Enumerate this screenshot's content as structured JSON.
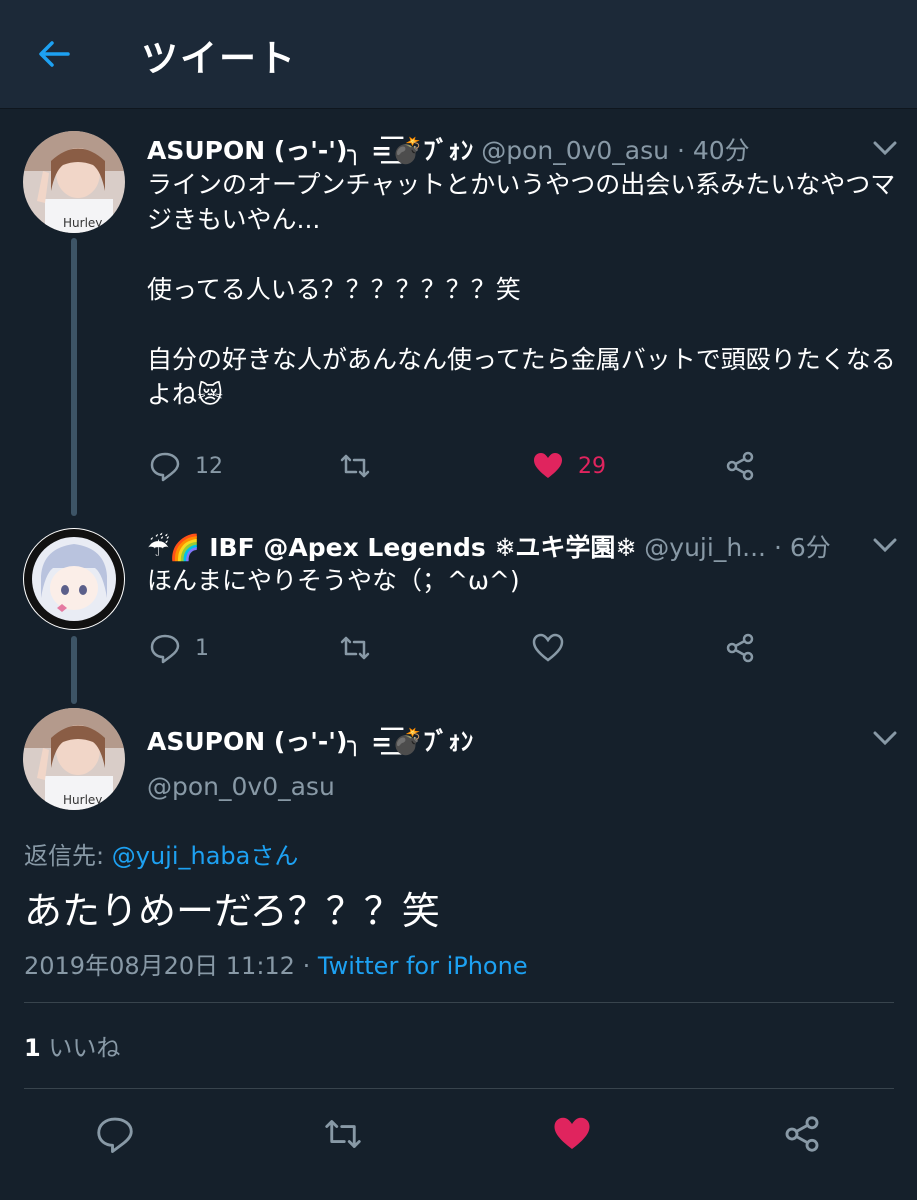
{
  "header": {
    "title": "ツイート"
  },
  "tweet1": {
    "name": "ASUPON (っ'-')╮ =͟͟͞͞💣ﾌﾞｫﾝ",
    "handle": "@pon_0v0_asu",
    "time": "· 40分",
    "text": "ラインのオープンチャットとかいうやつの出会い系みたいなやつマジきもいやん...\n\n使ってる人いる？？？？？？？笑\n\n自分の好きな人があんなん使ってたら金属バットで頭殴りたくなるよね😿",
    "replies": "12",
    "likes": "29"
  },
  "tweet2": {
    "name": "☔🌈 IBF @Apex Legends ❄ユキ学園❄",
    "handle": "@yuji_h...",
    "time": "· 6分",
    "text": "ほんまにやりそうやな（；^ω^)",
    "replies": "1"
  },
  "main": {
    "name": "ASUPON (っ'-')╮ =͟͟͞͞💣ﾌﾞｫﾝ",
    "handle": "@pon_0v0_asu",
    "reply_prefix": "返信先:",
    "reply_to": "@yuji_habaさん",
    "text": "あたりめーだろ？？？笑",
    "date": "2019年08月20日 11:12",
    "dot": "·",
    "source": "Twitter for iPhone",
    "like_count": "1",
    "like_label": "いいね"
  },
  "colors": {
    "accent": "#1da1f2",
    "like": "#e0245e",
    "background": "#15202b",
    "muted": "#8899a6"
  }
}
